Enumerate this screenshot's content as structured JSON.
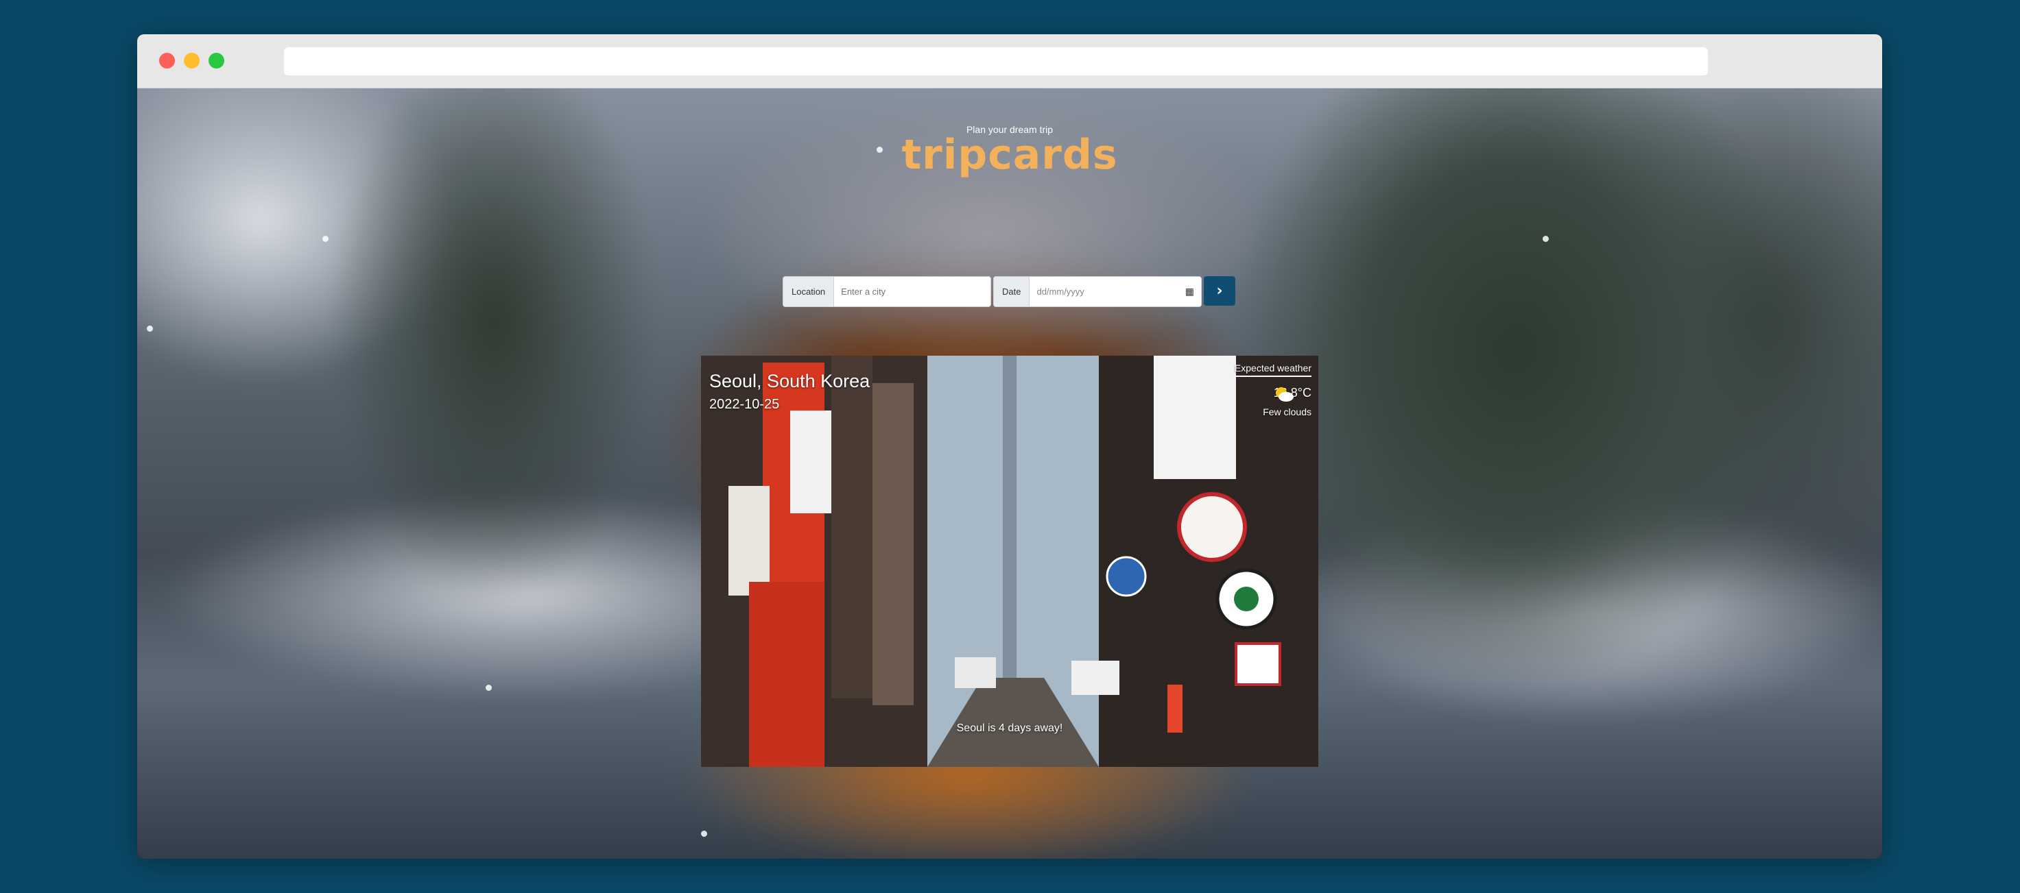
{
  "browser": {
    "url": ""
  },
  "hero": {
    "subtitle": "Plan your dream trip",
    "title": "tripcards"
  },
  "form": {
    "location_label": "Location",
    "location_placeholder": "Enter a city",
    "date_label": "Date",
    "date_placeholder": "dd/mm/yyyy",
    "submit_icon": "chevron-right-icon"
  },
  "card": {
    "city": "Seoul, South Korea",
    "date": "2022-10-25",
    "weather_label": "Expected weather",
    "temperature": "16.8°C",
    "weather_icon": "partly-cloudy-icon",
    "description": "Few clouds",
    "countdown": "Seoul is 4 days away!"
  },
  "colors": {
    "brand": "#f2b15a",
    "submit": "#0f4e72",
    "page_bg": "#0a4866"
  }
}
